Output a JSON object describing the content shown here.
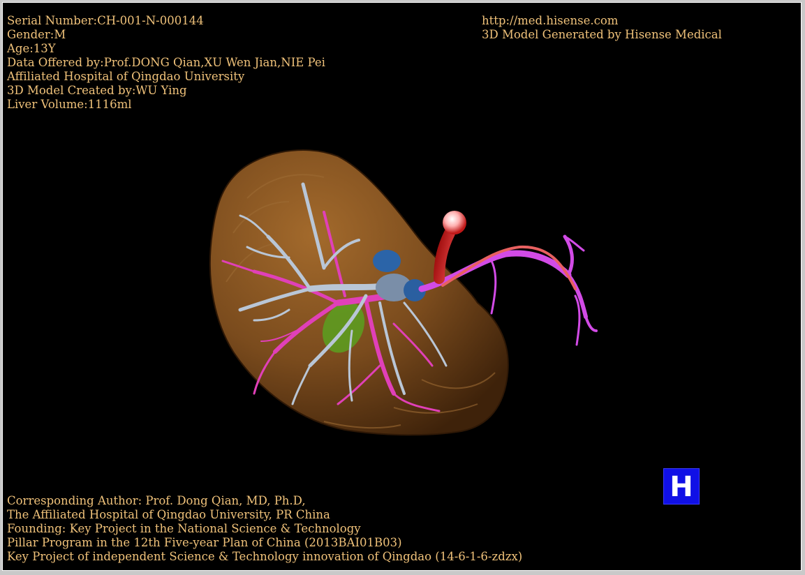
{
  "info_top_left": [
    "Serial Number:CH-001-N-000144",
    "Gender:M",
    "Age:13Y",
    "Data Offered by:Prof.DONG Qian,XU Wen Jian,NIE Pei",
    "Affiliated Hospital of Qingdao University",
    "3D Model Created by:WU Ying",
    "Liver Volume:1116ml"
  ],
  "info_top_right": [
    "http://med.hisense.com",
    "3D Model Generated by Hisense Medical"
  ],
  "info_bottom_left": [
    "Corresponding Author: Prof. Dong Qian, MD, Ph.D,",
    "The Affiliated Hospital of Qingdao University, PR China",
    "Founding: Key Project in the National Science & Technology",
    "Pillar Program in the 12th Five-year Plan of China (2013BAI01B03)",
    "Key Project of independent Science & Technology innovation of Qingdao (14-6-1-6-zdzx)"
  ],
  "badge": {
    "label": "H"
  },
  "colors": {
    "background": "#000000",
    "text": "#f0c27a",
    "liver": "#7a4a1c",
    "hepatic_vein": "#b9c6d6",
    "portal_vein": "#e040b8",
    "splenic_vein": "#d24be6",
    "artery": "#d83a3a",
    "gallbladder": "#5aa020",
    "badge": "#1010e6"
  }
}
